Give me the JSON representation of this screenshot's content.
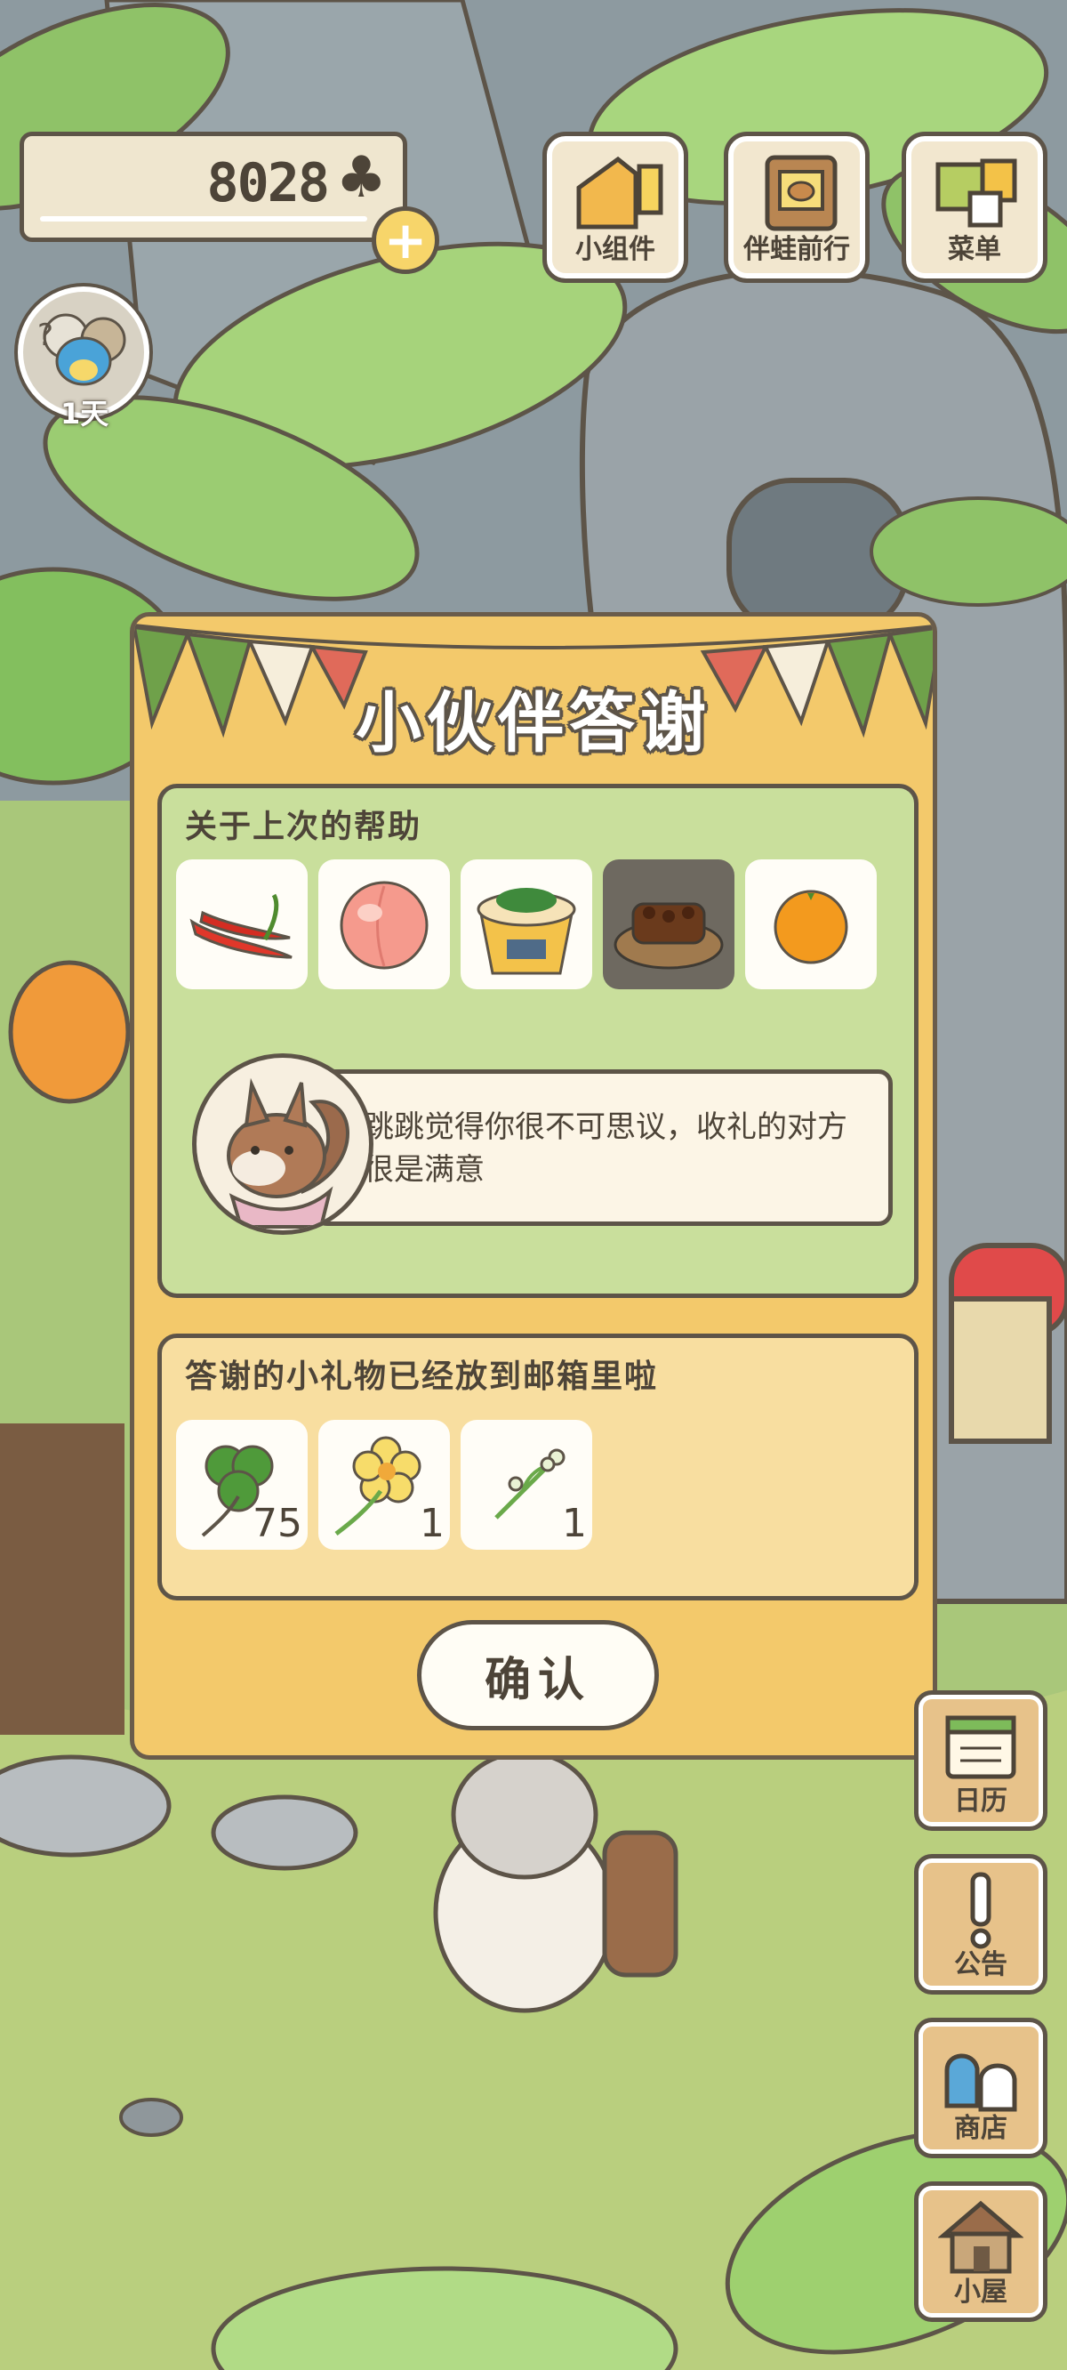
{
  "hud": {
    "clover_count": "8028",
    "clover_symbol": "♣",
    "add_symbol": "+",
    "buttons": [
      {
        "label": "小组件",
        "icon": "widget-icon"
      },
      {
        "label": "伴蛙前行",
        "icon": "journey-book-icon"
      },
      {
        "label": "菜单",
        "icon": "menu-icon"
      }
    ],
    "avatar_days": "1天"
  },
  "dialog": {
    "title": "小伙伴答谢",
    "help_section": {
      "heading": "关于上次的帮助",
      "items": [
        {
          "icon": "chili-pepper-icon"
        },
        {
          "icon": "peach-icon"
        },
        {
          "icon": "noodle-cup-icon"
        },
        {
          "icon": "grilled-meat-plate-icon",
          "selected": true
        },
        {
          "icon": "orange-icon"
        }
      ],
      "message": "跳跳觉得你很不可思议，收礼的对方很是满意"
    },
    "gift_section": {
      "heading": "答谢的小礼物已经放到邮箱里啦",
      "gifts": [
        {
          "icon": "clover-icon",
          "qty": "75"
        },
        {
          "icon": "yellow-flower-icon",
          "qty": "1"
        },
        {
          "icon": "flower-sprout-icon",
          "qty": "1"
        }
      ]
    },
    "confirm_label": "确认"
  },
  "side_buttons": [
    {
      "label": "日历",
      "icon": "calendar-icon"
    },
    {
      "label": "公告",
      "icon": "notice-icon"
    },
    {
      "label": "商店",
      "icon": "shop-bag-icon"
    },
    {
      "label": "小屋",
      "icon": "house-icon"
    }
  ],
  "colors": {
    "panel": "#f3c96b",
    "outline": "#5d5448",
    "green_panel": "#c9df9c",
    "cream_panel": "#f8dea0"
  }
}
